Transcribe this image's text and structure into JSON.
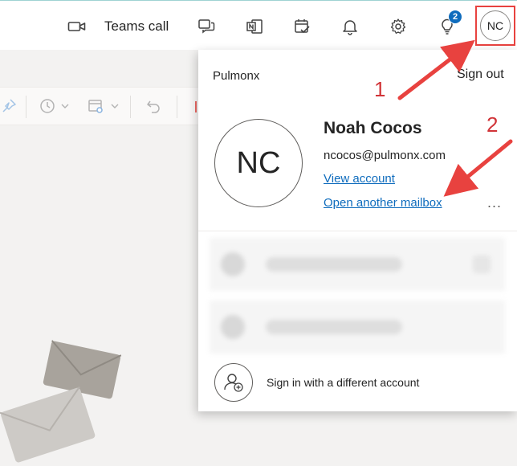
{
  "header": {
    "teams_call_label": "Teams call",
    "notification_badge": "2",
    "avatar_initials": "NC",
    "icons": [
      "video-icon",
      "chat-icon",
      "onenote-icon",
      "calendar-check-icon",
      "bell-icon",
      "gear-icon",
      "lightbulb-icon"
    ]
  },
  "toolbar": {
    "icons": [
      "pin-icon",
      "clock-icon",
      "chevron-down-icon",
      "calendar-gear-icon",
      "chevron-down-icon",
      "undo-icon"
    ]
  },
  "account_panel": {
    "tenant": "Pulmonx",
    "sign_out": "Sign out",
    "avatar_initials": "NC",
    "name": "Noah Cocos",
    "email": "ncocos@pulmonx.com",
    "view_account": "View account",
    "open_another_mailbox": "Open another mailbox",
    "more_label": "...",
    "sign_in_different": "Sign in with a different account"
  },
  "annotations": {
    "label_1": "1",
    "label_2": "2",
    "color": "#e8423f"
  },
  "colors": {
    "link": "#0f6cbd",
    "badge": "#0f6cbd",
    "highlight_box": "#e8423f"
  }
}
